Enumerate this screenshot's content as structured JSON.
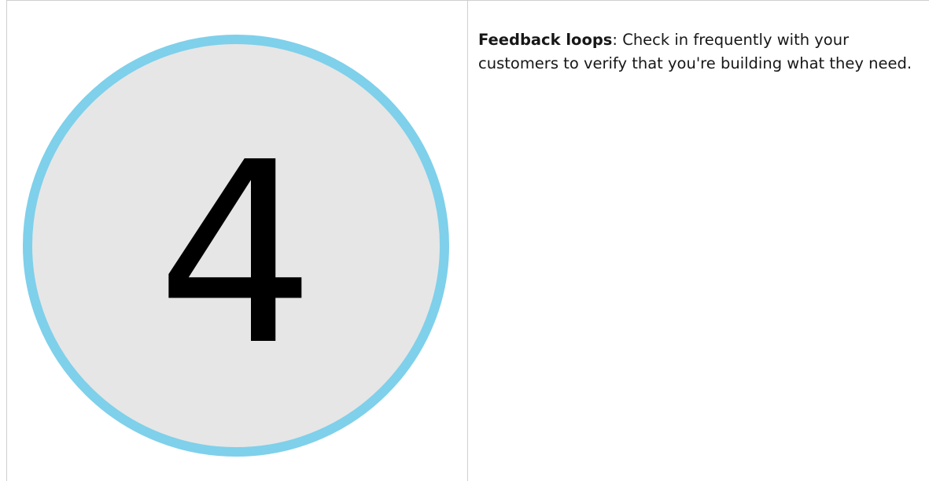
{
  "step": {
    "number": "4",
    "circle_fill": "#e6e6e6",
    "circle_stroke": "#7fd0ea",
    "numeral_color": "#000000"
  },
  "description": {
    "term": "Feedback loops",
    "separator": ":",
    "text": " Check in frequently with your customers to verify that you're building what they need."
  },
  "colors": {
    "border": "#cfcfcf",
    "text": "#171717"
  }
}
